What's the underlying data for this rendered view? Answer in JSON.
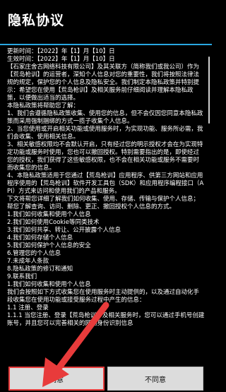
{
  "dialog": {
    "title": "隐私协议"
  },
  "content": {
    "lines": [
      "更新时间：【2022】年【1】月【10】日",
      "生效时间：【2022】年【1】月【10】日",
      "【石家庄舍古网络科技有限公司】及其关联方（简称我们或我公司）作为【荒岛枪训】的运营者，深知个人信息对您的重要性，我们将按照法律法规的规定，保护您的个人信息及隐私安全。我们制定本隐私政策并特别提示：希望您在使用【荒岛枪训】及相关服务前仔细阅读并理解本隐私政策，以便做出适当的选择。",
      "本隐私政策将帮助您了解：",
      "1、我们会遵循隐私政策收集、使用您的信息，但不会仅因您同意本隐私政策而采用强制捆绑的方式一揽子收集个人信息。",
      "2、当您使用或开启相关功能或使用服务时，为实现功能、服务所必需，我们会收集、使用相关信息。",
      "3、相关敏感权限均不会默认开启，只有经过您的明示授权才会在为实现特定功能或服务时使用，您也可以撤回授权。特别需要指出的是，即使经过您的授权，我们获得了这些敏感权限，也不会在相关功能或服务不需要时而收集您的信息。",
      "4、本隐私政策适用于您通过【荒岛枪训】应用程序、供第三方网站和应用程序使用的【荒岛枪训】软件开发工具包（SDK）和应用程序编程接口（API）方式来访问和使用我们的产品和服务。",
      "下文将帮您详细了解我们如何收集、使用、存储、传输与保护个人信息；帮您了解查询、访问、删除、更正、撤回授权个人信息的方式。",
      "1.我们如何收集和使用个人信息",
      "2.我们如何使用Cookie等同类技术",
      "3.我们如何共享、转让、公开披露个人信息",
      "4.我们如何存储个人信息",
      "5.我们如何保护个人信息的安全",
      "6.管理您的个人信息",
      "7.未成年人条款",
      "8.隐私政策的修订和通知",
      "9.联系我们",
      "1.我们如何收集和使用个人信息",
      "我们会按照如下方式收集您在使用服务时主动提供的，以及通过自动化手段收集您在使用功能或接受服务过程中产生的信息：",
      "1.1 注册、登录",
      "1.1.1 当您注册、登录【荒岛枪训】及相关服务时，您可以通过手机号创建账号，并且您可以完善相关的网络身份识别信息"
    ]
  },
  "buttons": {
    "agree": "同意",
    "disagree": "不同意"
  },
  "annotation": {
    "arrow_color": "#e83b3b"
  }
}
